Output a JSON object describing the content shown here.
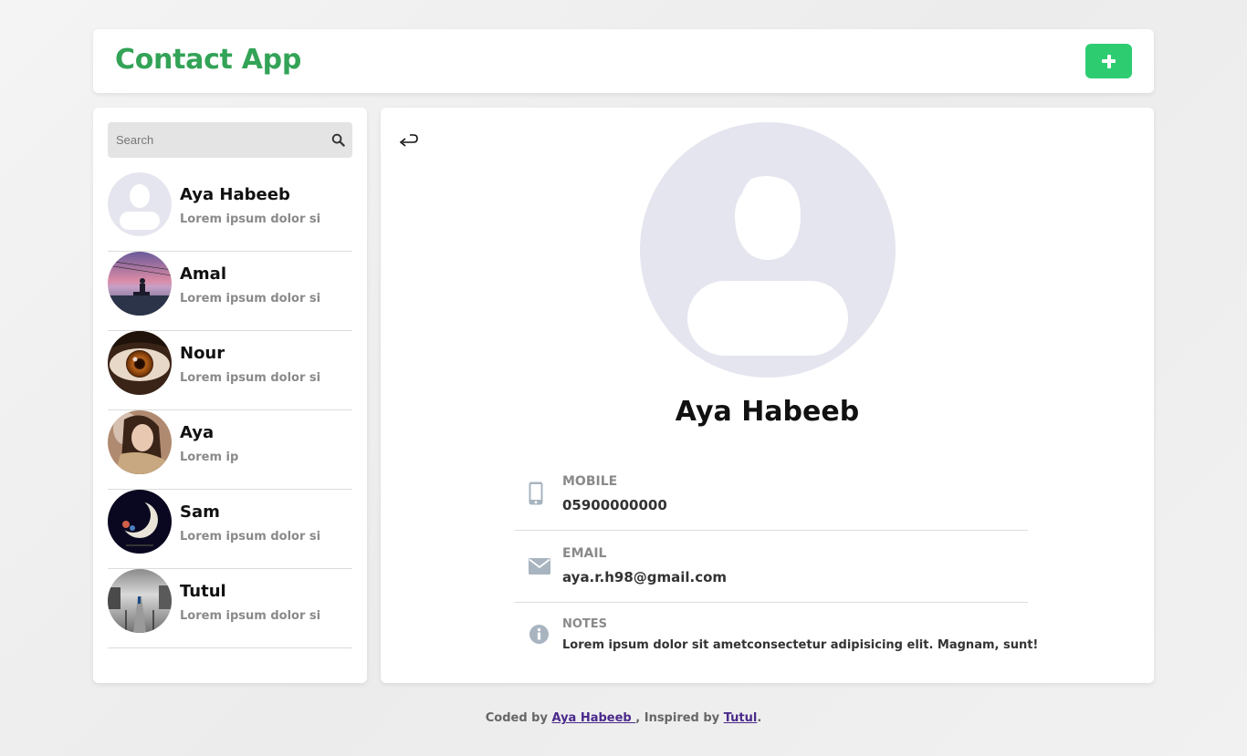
{
  "header": {
    "title": "Contact App",
    "add_button_icon": "plus-icon"
  },
  "search": {
    "placeholder": "Search",
    "value": "",
    "icon": "search-icon"
  },
  "contacts": [
    {
      "name": "Aya Habeeb",
      "preview": "Lorem ipsum dolor si",
      "avatar": "default-avatar"
    },
    {
      "name": "Amal",
      "preview": "Lorem ipsum dolor si",
      "avatar": "photo-sunset"
    },
    {
      "name": "Nour",
      "preview": "Lorem ipsum dolor si",
      "avatar": "photo-eye"
    },
    {
      "name": "Aya",
      "preview": "Lorem ip",
      "avatar": "photo-girl"
    },
    {
      "name": "Sam",
      "preview": "Lorem ipsum dolor si",
      "avatar": "photo-moon"
    },
    {
      "name": "Tutul",
      "preview": "Lorem ipsum dolor si",
      "avatar": "photo-pier"
    }
  ],
  "detail": {
    "name": "Aya Habeeb",
    "back_icon": "return-arrow-icon",
    "fields": {
      "mobile": {
        "label": "MOBILE",
        "value": "05900000000",
        "icon": "mobile-phone-icon"
      },
      "email": {
        "label": "EMAIL",
        "value": "aya.r.h98@gmail.com",
        "icon": "envelope-icon"
      },
      "notes": {
        "label": "NOTES",
        "value": "Lorem ipsum dolor sit ametconsectetur adipisicing elit. Magnam, sunt!",
        "icon": "info-icon"
      }
    }
  },
  "footer": {
    "prefix": "Coded by",
    "author_link": "Aya Habeeb ",
    "middle": ", Inspired by",
    "inspiration_link": "Tutul",
    "suffix": "."
  },
  "colors": {
    "brand_green": "#33a357",
    "button_green": "#2ecc71",
    "avatar_placeholder": "#e5e5ef",
    "icon_gray": "#a8b4c0"
  }
}
